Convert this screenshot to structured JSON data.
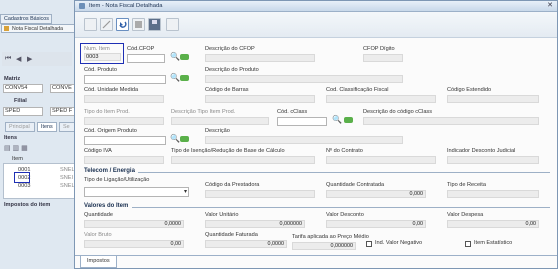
{
  "background_window": {
    "tab_cadastros": "Cadastros Básicos",
    "tab_nota": "Nota Fiscal Detalhada",
    "matriz_label": "Matriz",
    "matriz_value": "CONV54",
    "matriz_value2": "CONVE",
    "filial_label": "Filial",
    "filial_value": "SPED",
    "filial_value2": "SPED F",
    "principal_tab": "Principal",
    "itens_tab": "Itens",
    "itens_header": "Itens",
    "item_col": "Item",
    "rows": [
      "0001",
      "0002",
      "0003"
    ],
    "row_suffix": [
      "SNEL",
      "SNEI",
      "SNEL"
    ],
    "impostos_label": "Impostos do item",
    "itens_bottom_tab": "Itens",
    "se_tab": "Se"
  },
  "window": {
    "title": "Item - Nota Fiscal Detalhada"
  },
  "fields": {
    "num_item_label": "Num. Item",
    "num_item_value": "0003",
    "cod_cfop_label": "Cód.CFOP",
    "descricao_cfop_label": "Descrição do CFOP",
    "cfop_digito_label": "CFOP Dígito",
    "cod_produto_label": "Cód. Produto",
    "descricao_produto_label": "Descrição do Produto",
    "cod_unidade_label": "Cód. Unidade Medida",
    "codigo_barras_label": "Código de Barras",
    "cod_classificacao_label": "Cod. Classificação Fiscal",
    "codigo_estendido_label": "Código Estendido",
    "tipo_item_label": "Tipo do Item Prod.",
    "descricao_tipo_item_label": "Descrição Tipo Item Prod.",
    "cod_class_label": "Cód. cClass",
    "descricao_cclass_label": "Descrição do código cClass",
    "cod_origem_label": "Cód. Origem Produto",
    "descricao_label": "Descrição",
    "codigo_iva_label": "Código IVA",
    "tipo_isencao_label": "Tipo de Isenção/Redução de Base de Cálculo",
    "num_contrato_label": "Nº do Contrato",
    "indicador_desconto_label": "Indicador Desconto Judicial"
  },
  "telecom": {
    "section_title": "Telecom / Energia",
    "tipo_ligacao_label": "Tipo de Ligação/Utilização",
    "codigo_prestadora_label": "Código da Prestadora",
    "quantidade_contratada_label": "Quantidade Contratada",
    "quantidade_contratada_value": "0,000",
    "tipo_receita_label": "Tipo de Receita"
  },
  "valores": {
    "section_title": "Valores do Item",
    "quantidade_label": "Quantidade",
    "quantidade_value": "0,0000",
    "valor_unitario_label": "Valor Unitário",
    "valor_unitario_value": "0,000000",
    "valor_desconto_label": "Valor Desconto",
    "valor_desconto_value": "0,00",
    "valor_despesa_label": "Valor Despesa",
    "valor_despesa_value": "0,00",
    "valor_bruto_label": "Valor Bruto",
    "valor_bruto_value": "0,00",
    "quantidade_faturada_label": "Quantidade Faturada",
    "quantidade_faturada_value": "0,0000",
    "tarifa_label": "Tarifa aplicada ao Preço Médio",
    "tarifa_value": "0,000000",
    "ind_valor_negativo_label": "Ind. Valor Negativo",
    "item_estatistico_label": "Item Estatístico"
  },
  "bottom_tab": "Impostos",
  "colors": {
    "highlight": "#1e2fb4",
    "window_border": "#7e97b4",
    "titlebar": "#c8d8ea"
  }
}
